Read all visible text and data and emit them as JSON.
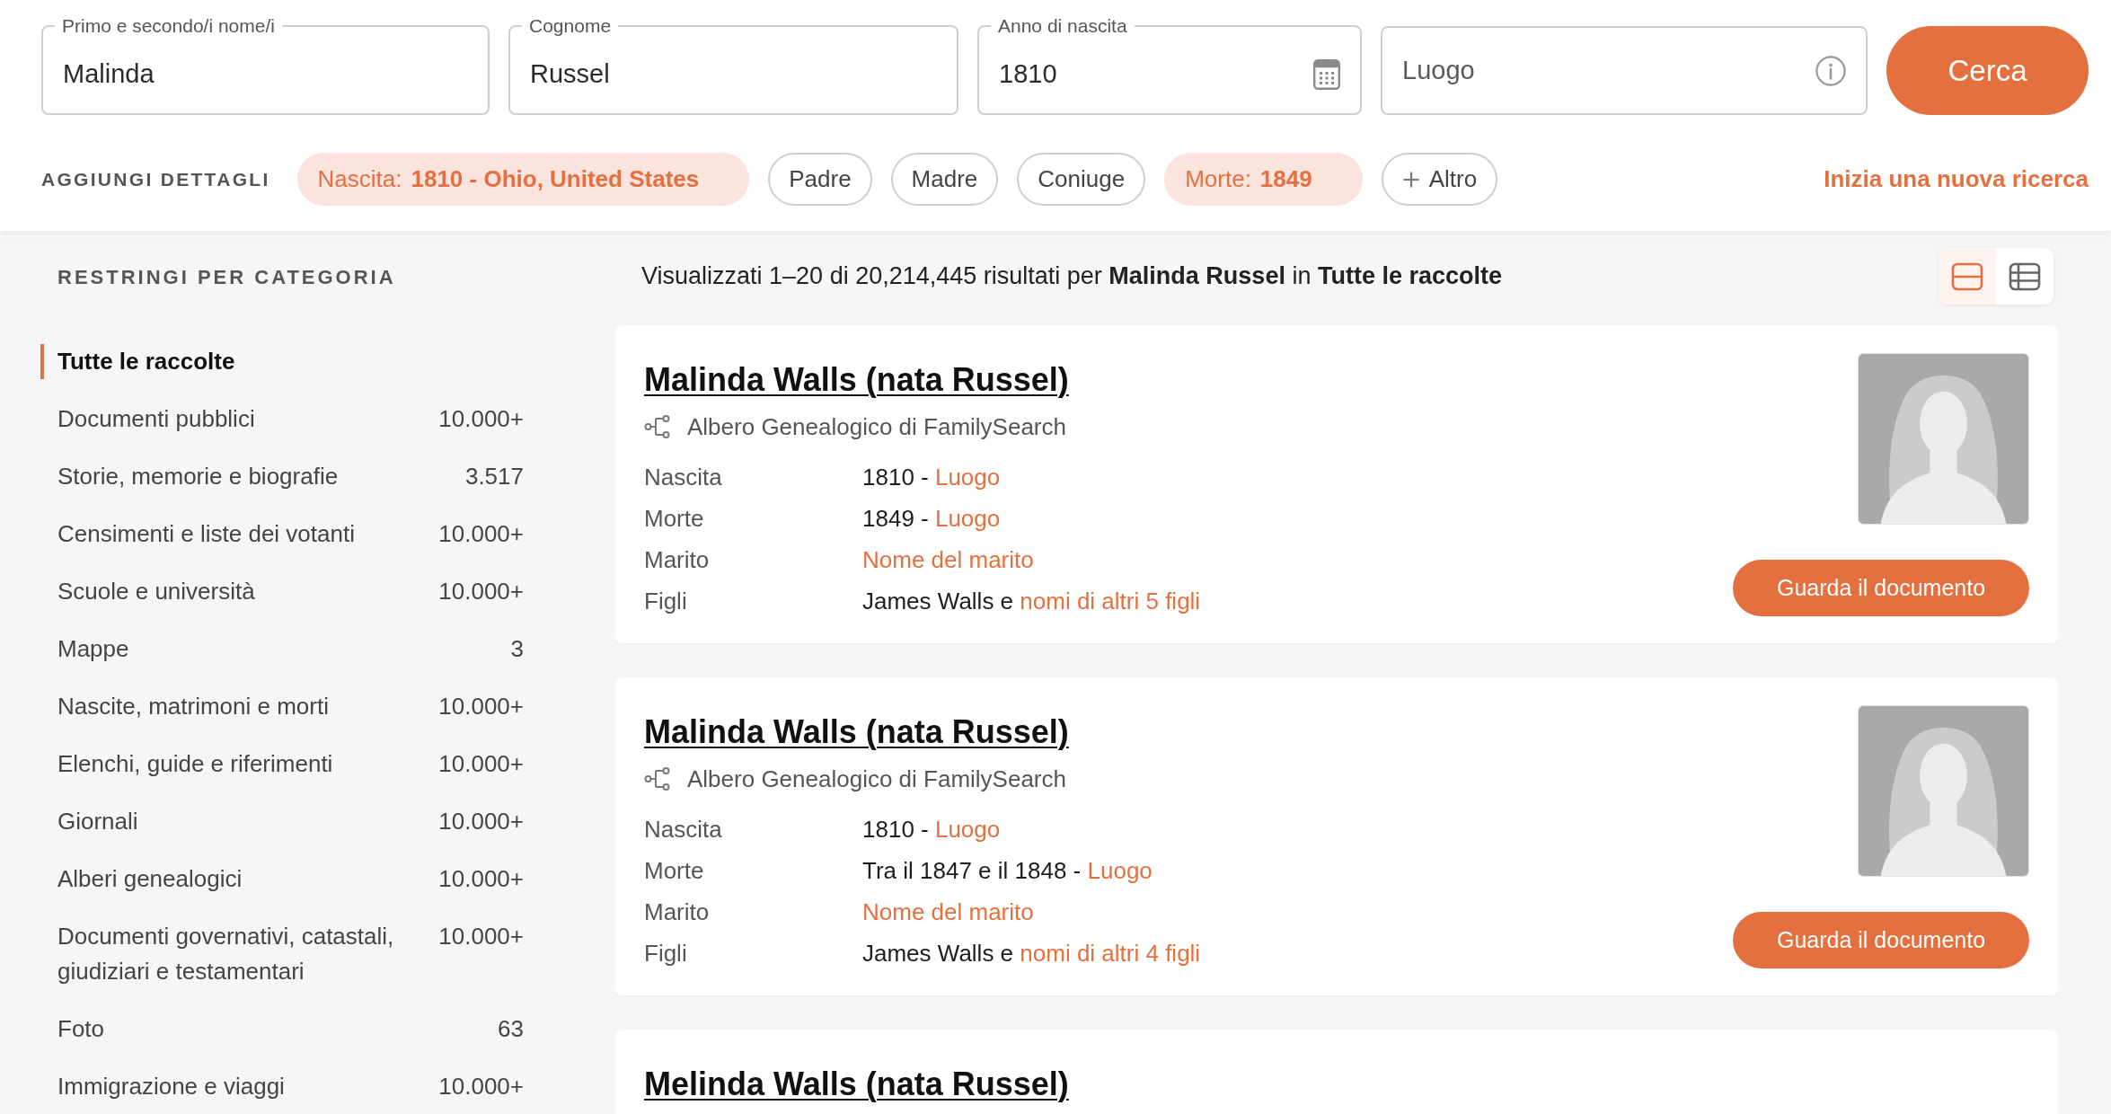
{
  "search_form": {
    "fields": [
      {
        "kind": "text",
        "label": "Primo e secondo/i nome/i",
        "value": "Malinda"
      },
      {
        "kind": "text",
        "label": "Cognome",
        "value": "Russel"
      },
      {
        "kind": "date",
        "label": "Anno di nascita",
        "value": "1810"
      },
      {
        "kind": "place",
        "placeholder": "Luogo"
      }
    ],
    "submit": "Cerca"
  },
  "details": {
    "label": "AGGIUNGI DETTAGLI",
    "chips": [
      {
        "kind": "filled",
        "text": "Nascita: **1810 - Ohio, United States**"
      },
      {
        "kind": "outline",
        "text": "Padre"
      },
      {
        "kind": "outline",
        "text": "Madre"
      },
      {
        "kind": "outline",
        "text": "Coniuge"
      },
      {
        "kind": "filled",
        "text": "Morte: **1849**"
      },
      {
        "kind": "add",
        "text": "Altro"
      }
    ],
    "reset_link": "Inizia una nuova ricerca"
  },
  "sidebar": {
    "title": "RESTRINGI PER CATEGORIA",
    "items": [
      {
        "label": "Tutte le raccolte",
        "selected": true
      },
      {
        "label": "Documenti pubblici",
        "count": "10.000+",
        "selected": false
      },
      {
        "label": "Storie, memorie e biografie",
        "count": "3.517",
        "selected": false
      },
      {
        "label": "Censimenti e liste dei votanti",
        "count": "10.000+",
        "selected": false
      },
      {
        "label": "Scuole e università",
        "count": "10.000+",
        "selected": false
      },
      {
        "label": "Mappe",
        "count": "3",
        "selected": false
      },
      {
        "label": "Nascite, matrimoni e morti",
        "count": "10.000+",
        "selected": false
      },
      {
        "label": "Elenchi, guide e riferimenti",
        "count": "10.000+",
        "selected": false
      },
      {
        "label": "Giornali",
        "count": "10.000+",
        "selected": false
      },
      {
        "label": "Alberi genealogici",
        "count": "10.000+",
        "selected": false
      },
      {
        "label": "Documenti governativi, catastali, giudiziari e testamentari",
        "count": "10.000+",
        "selected": false
      },
      {
        "label": "Foto",
        "count": "63",
        "selected": false
      },
      {
        "label": "Immigrazione e viaggi",
        "count": "10.000+",
        "selected": false
      }
    ]
  },
  "results": {
    "summary": "Visualizzati 1–20 di 20,214,445 risultati per **Malinda Russel** in **Tutte le raccolte**",
    "view_toggle": [
      {
        "kind": "cards",
        "selected": true
      },
      {
        "kind": "table",
        "selected": false
      }
    ],
    "records": [
      {
        "name": "Malinda Walls (nata Russel)",
        "source": "Albero Genealogico di FamilySearch",
        "facts": [
          {
            "label": "Nascita",
            "text": "1810 -",
            "link": "Luogo"
          },
          {
            "label": "Morte",
            "text": "1849 -",
            "link": "Luogo"
          },
          {
            "label": "Marito",
            "link": "Nome del marito"
          },
          {
            "label": "Figli",
            "text": "James Walls e",
            "link": "nomi di altri 5 figli"
          }
        ],
        "button": "Guarda il documento"
      },
      {
        "name": "Malinda Walls (nata Russel)",
        "source": "Albero Genealogico di FamilySearch",
        "facts": [
          {
            "label": "Nascita",
            "text": "1810 -",
            "link": "Luogo"
          },
          {
            "label": "Morte",
            "text": "Tra il 1847 e il 1848 -",
            "link": "Luogo"
          },
          {
            "label": "Marito",
            "link": "Nome del marito"
          },
          {
            "label": "Figli",
            "text": "James Walls e",
            "link": "nomi di altri 4 figli"
          }
        ],
        "button": "Guarda il documento"
      },
      {
        "name": "Melinda Walls (nata Russel)"
      }
    ]
  }
}
